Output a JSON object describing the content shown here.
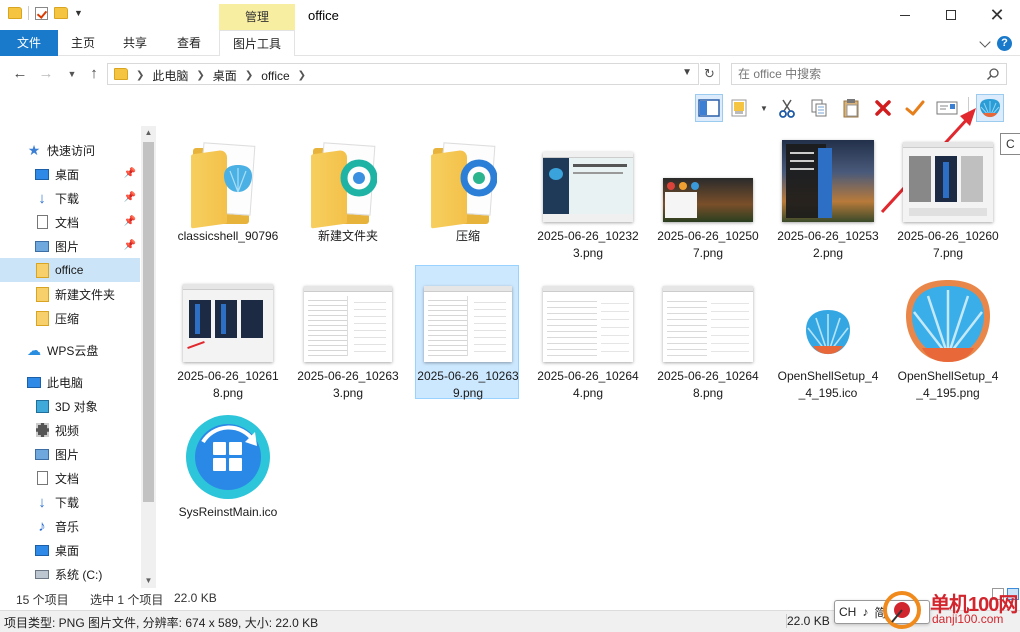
{
  "window": {
    "title": "office",
    "context_tab_group": "管理",
    "minimize": "—",
    "maximize": "□",
    "close": "✕"
  },
  "ribbon": {
    "tabs": [
      "文件",
      "主页",
      "共享",
      "查看",
      "图片工具"
    ],
    "help": "?"
  },
  "address": {
    "crumbs": [
      "此电脑",
      "桌面",
      "office"
    ],
    "search_placeholder": "在 office 中搜索"
  },
  "nav": {
    "quick_access": "快速访问",
    "quick_items": [
      "桌面",
      "下载",
      "文档",
      "图片",
      "office",
      "新建文件夹",
      "压缩"
    ],
    "wps_cloud": "WPS云盘",
    "this_pc": "此电脑",
    "pc_items": [
      "3D 对象",
      "视频",
      "图片",
      "文档",
      "下载",
      "音乐",
      "桌面",
      "系统 (C:)"
    ]
  },
  "files": [
    {
      "name": "classicshell_90796",
      "kind": "folder"
    },
    {
      "name": "新建文件夹",
      "kind": "folder"
    },
    {
      "name": "压缩",
      "kind": "folder"
    },
    {
      "name": "2025-06-26_102323.png",
      "kind": "screenshot"
    },
    {
      "name": "2025-06-26_102507.png",
      "kind": "screenshot"
    },
    {
      "name": "2025-06-26_102532.png",
      "kind": "screenshot"
    },
    {
      "name": "2025-06-26_102607.png",
      "kind": "screenshot"
    },
    {
      "name": "2025-06-26_102618.png",
      "kind": "screenshot"
    },
    {
      "name": "2025-06-26_102633.png",
      "kind": "screenshot"
    },
    {
      "name": "2025-06-26_102639.png",
      "kind": "screenshot",
      "selected": true
    },
    {
      "name": "2025-06-26_102644.png",
      "kind": "screenshot"
    },
    {
      "name": "2025-06-26_102648.png",
      "kind": "screenshot"
    },
    {
      "name": "OpenShellSetup_4_4_195.ico",
      "kind": "shell-icon"
    },
    {
      "name": "OpenShellSetup_4_4_195.png",
      "kind": "shell-icon"
    },
    {
      "name": "SysReinstMain.ico",
      "kind": "sysreinst-icon"
    }
  ],
  "status": {
    "count": "15 个项目",
    "selected": "选中 1 个项目",
    "size": "22.0 KB"
  },
  "details": {
    "info": "项目类型: PNG 图片文件, 分辨率: 674 x 589, 大小: 22.0 KB",
    "size": "22.0 KB"
  },
  "ime": {
    "lang": "CH",
    "mode": "♪",
    "simp": "简"
  },
  "tooltip_peek": "C",
  "watermark": {
    "brand": "单机100网",
    "url": "danji100.com"
  },
  "colors": {
    "accent": "#1979ca",
    "selection": "#cce8ff",
    "context_tab": "#f8eea2",
    "annotation": "#e0282e"
  }
}
